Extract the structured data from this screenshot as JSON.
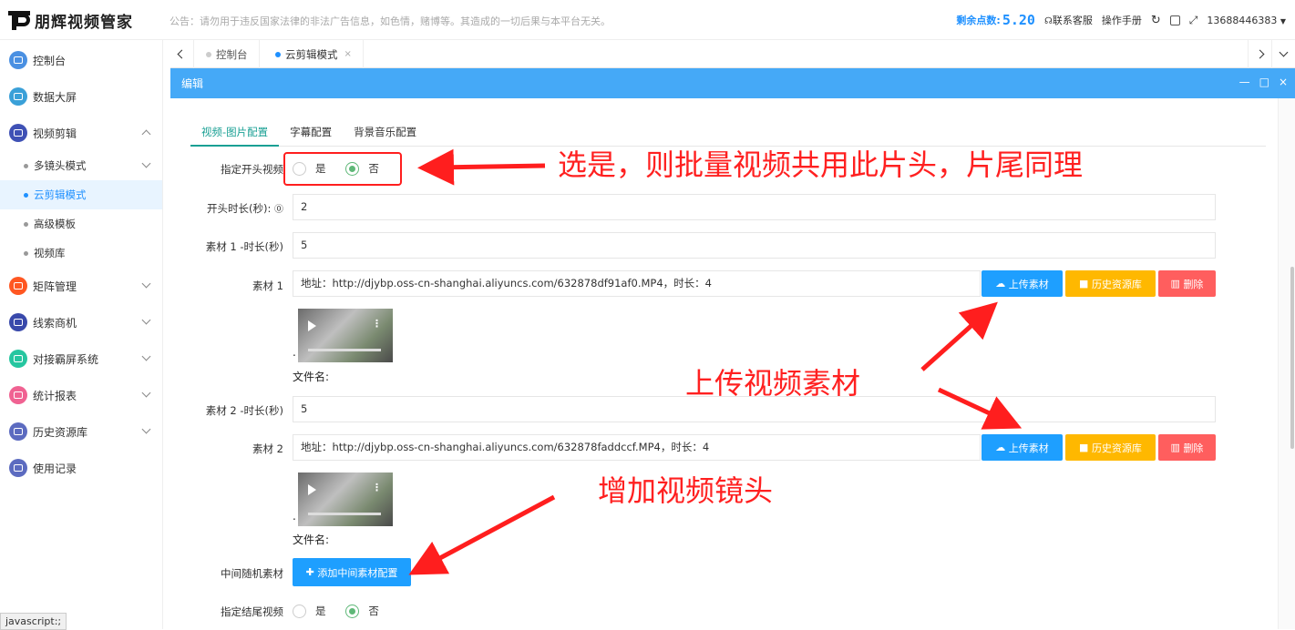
{
  "app": {
    "logo_text": "朋辉视频管家"
  },
  "header": {
    "notice": "公告：请勿用于违反国家法律的非法广告信息，如色情，赌博等。其造成的一切后果与本平台无关。",
    "points_label": "剩余点数:",
    "points_value": "5.20",
    "service": "联系客服",
    "manual": "操作手册",
    "user": "13688446383"
  },
  "sidebar": {
    "items": [
      {
        "label": "控制台",
        "color": "#4a90e2"
      },
      {
        "label": "数据大屏",
        "color": "#3aa0d8"
      },
      {
        "label": "视频剪辑",
        "color": "#3f51b5"
      },
      {
        "label": "矩阵管理",
        "color": "#ff5722"
      },
      {
        "label": "线索商机",
        "color": "#3949ab"
      },
      {
        "label": "对接霸屏系统",
        "color": "#26c6a0"
      },
      {
        "label": "统计报表",
        "color": "#f06292"
      },
      {
        "label": "历史资源库",
        "color": "#5c6bc0"
      },
      {
        "label": "使用记录",
        "color": "#5c6bc0"
      }
    ],
    "sub_items": [
      {
        "label": "多镜头模式"
      },
      {
        "label": "云剪辑模式"
      },
      {
        "label": "高级模板"
      },
      {
        "label": "视频库"
      }
    ]
  },
  "tabs": [
    {
      "label": "控制台"
    },
    {
      "label": "云剪辑模式",
      "close": "×"
    }
  ],
  "panel": {
    "title": "编辑",
    "min": "—",
    "max": "□",
    "close": "×"
  },
  "form_tabs": [
    "视频-图片配置",
    "字幕配置",
    "背景音乐配置"
  ],
  "form": {
    "opening_label": "指定开头视频",
    "yes": "是",
    "no": "否",
    "opening_duration_label": "开头时长(秒):",
    "opening_duration_value": "2",
    "m1_duration_label": "素材 1 -时长(秒)",
    "m1_duration_value": "5",
    "m1_label": "素材 1",
    "m1_value": "地址：http://djybp.oss-cn-shanghai.aliyuncs.com/632878df91af0.MP4，时长：4",
    "file_name_label": "文件名:",
    "m2_duration_label": "素材 2 -时长(秒)",
    "m2_duration_value": "5",
    "m2_label": "素材 2",
    "m2_value": "地址：http://djybp.oss-cn-shanghai.aliyuncs.com/632878faddccf.MP4，时长：4",
    "random_label": "中间随机素材",
    "add_button": "添加中间素材配置",
    "ending_label": "指定结尾视频",
    "upload": "上传素材",
    "history": "历史资源库",
    "delete": "删除",
    "dot_mark": "."
  },
  "annotations": {
    "a1": "选是，则批量视频共用此片头，片尾同理",
    "a2": "上传视频素材",
    "a3": "增加视频镜头"
  },
  "status_bar": "javascript:;"
}
